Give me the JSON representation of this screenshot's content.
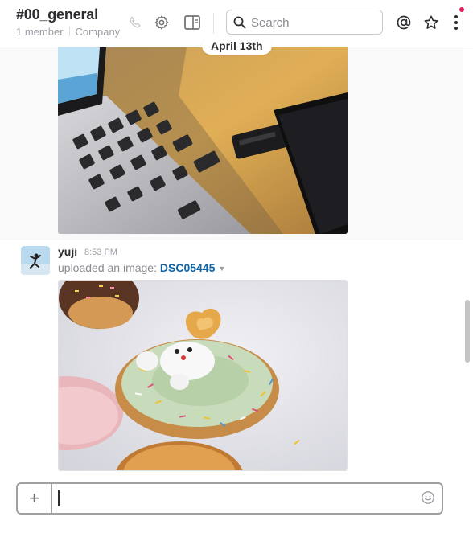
{
  "header": {
    "channel_name": "#00_general",
    "member_count": "1 member",
    "topic": "Company",
    "icons": [
      "phone-icon",
      "gear-icon",
      "sidebar-toggle-icon"
    ],
    "search_placeholder": "Search",
    "right_icons": [
      "at-mention-icon",
      "star-icon",
      "more-vertical-icon"
    ],
    "notification_color": "#e01e5a"
  },
  "date_divider": "April 13th",
  "messages": [
    {
      "author": "yuji",
      "time": "8:53 PM",
      "action_text": "uploaded an image:",
      "file_name": "DSC05445",
      "attachment_icon": "chevron-down-icon"
    }
  ],
  "composer": {
    "add_label": "+",
    "emoji_icon": "emoji-icon",
    "value": ""
  },
  "colors": {
    "link": "#1264a3",
    "text": "#2c2d30",
    "muted": "#9e9ea6"
  }
}
